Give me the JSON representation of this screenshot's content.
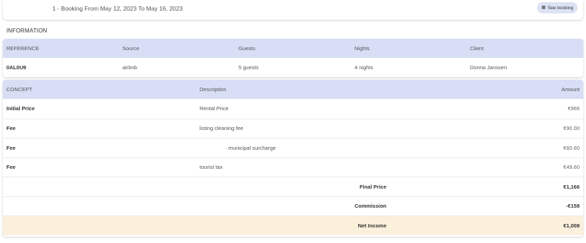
{
  "booking": {
    "title": "1 - Booking From May 12, 2023 To May 16, 2023",
    "see_booking_label": "See booking",
    "see_booking_icon": "calendar-icon"
  },
  "information": {
    "section_label": "INFORMATION",
    "headers": [
      "REFERENCE",
      "Source",
      "Guests",
      "Nights",
      "Client"
    ],
    "row": [
      "0AL0U9",
      "airbnb",
      "5 guests",
      "4 nights",
      "Donna Janssen"
    ]
  },
  "concepts": {
    "headers": {
      "concept": "CONCEPT",
      "description": "Description",
      "amount": "Amount"
    },
    "rows": [
      {
        "concept": "Initial Price",
        "description": "Rental Price",
        "amount": "€966"
      },
      {
        "concept": "Fee",
        "description": "listing cleaning fee",
        "amount": "€90.00"
      },
      {
        "concept": "Fee",
        "description": "· municipal surcharge",
        "amount": "€60.60"
      },
      {
        "concept": "Fee",
        "description": "tourist tax",
        "amount": "€49.60"
      }
    ],
    "totals": [
      {
        "label": "Final Price",
        "amount": "€1,166"
      },
      {
        "label": "Commission",
        "amount": "-€158"
      },
      {
        "label": "Net Income",
        "amount": "€1,008"
      }
    ]
  },
  "colors": {
    "header_bg": "#d8def5",
    "button_bg": "#dde2f4",
    "net_income_bg": "#fbf0dc"
  }
}
